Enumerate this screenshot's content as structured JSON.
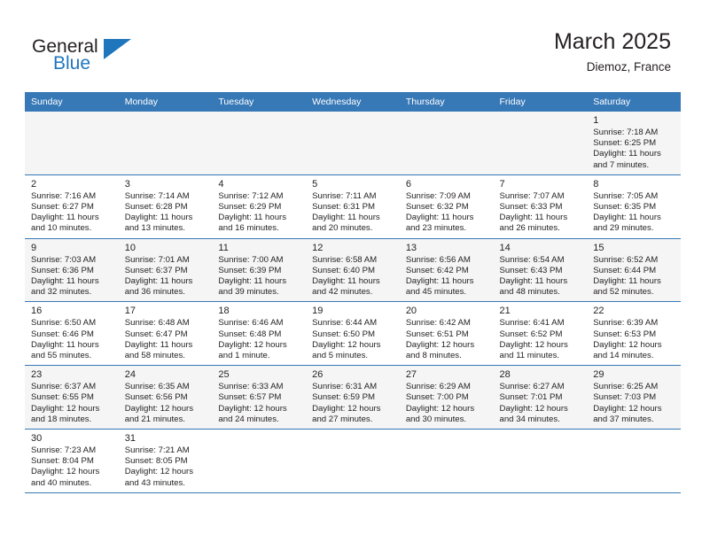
{
  "brand": {
    "name_part1": "General",
    "name_part2": "Blue",
    "logo_icon": "triangle-flag-icon"
  },
  "header": {
    "title": "March 2025",
    "location": "Diemoz, France"
  },
  "colors": {
    "header_blue": "#3778b6",
    "brand_blue": "#1f76bc",
    "text": "#231f20",
    "alt_row": "#f5f5f5"
  },
  "weekdays": [
    "Sunday",
    "Monday",
    "Tuesday",
    "Wednesday",
    "Thursday",
    "Friday",
    "Saturday"
  ],
  "calendar": {
    "weeks": [
      [
        {
          "day": "",
          "info": ""
        },
        {
          "day": "",
          "info": ""
        },
        {
          "day": "",
          "info": ""
        },
        {
          "day": "",
          "info": ""
        },
        {
          "day": "",
          "info": ""
        },
        {
          "day": "",
          "info": ""
        },
        {
          "day": "1",
          "info": "Sunrise: 7:18 AM\nSunset: 6:25 PM\nDaylight: 11 hours\nand 7 minutes."
        }
      ],
      [
        {
          "day": "2",
          "info": "Sunrise: 7:16 AM\nSunset: 6:27 PM\nDaylight: 11 hours\nand 10 minutes."
        },
        {
          "day": "3",
          "info": "Sunrise: 7:14 AM\nSunset: 6:28 PM\nDaylight: 11 hours\nand 13 minutes."
        },
        {
          "day": "4",
          "info": "Sunrise: 7:12 AM\nSunset: 6:29 PM\nDaylight: 11 hours\nand 16 minutes."
        },
        {
          "day": "5",
          "info": "Sunrise: 7:11 AM\nSunset: 6:31 PM\nDaylight: 11 hours\nand 20 minutes."
        },
        {
          "day": "6",
          "info": "Sunrise: 7:09 AM\nSunset: 6:32 PM\nDaylight: 11 hours\nand 23 minutes."
        },
        {
          "day": "7",
          "info": "Sunrise: 7:07 AM\nSunset: 6:33 PM\nDaylight: 11 hours\nand 26 minutes."
        },
        {
          "day": "8",
          "info": "Sunrise: 7:05 AM\nSunset: 6:35 PM\nDaylight: 11 hours\nand 29 minutes."
        }
      ],
      [
        {
          "day": "9",
          "info": "Sunrise: 7:03 AM\nSunset: 6:36 PM\nDaylight: 11 hours\nand 32 minutes."
        },
        {
          "day": "10",
          "info": "Sunrise: 7:01 AM\nSunset: 6:37 PM\nDaylight: 11 hours\nand 36 minutes."
        },
        {
          "day": "11",
          "info": "Sunrise: 7:00 AM\nSunset: 6:39 PM\nDaylight: 11 hours\nand 39 minutes."
        },
        {
          "day": "12",
          "info": "Sunrise: 6:58 AM\nSunset: 6:40 PM\nDaylight: 11 hours\nand 42 minutes."
        },
        {
          "day": "13",
          "info": "Sunrise: 6:56 AM\nSunset: 6:42 PM\nDaylight: 11 hours\nand 45 minutes."
        },
        {
          "day": "14",
          "info": "Sunrise: 6:54 AM\nSunset: 6:43 PM\nDaylight: 11 hours\nand 48 minutes."
        },
        {
          "day": "15",
          "info": "Sunrise: 6:52 AM\nSunset: 6:44 PM\nDaylight: 11 hours\nand 52 minutes."
        }
      ],
      [
        {
          "day": "16",
          "info": "Sunrise: 6:50 AM\nSunset: 6:46 PM\nDaylight: 11 hours\nand 55 minutes."
        },
        {
          "day": "17",
          "info": "Sunrise: 6:48 AM\nSunset: 6:47 PM\nDaylight: 11 hours\nand 58 minutes."
        },
        {
          "day": "18",
          "info": "Sunrise: 6:46 AM\nSunset: 6:48 PM\nDaylight: 12 hours\nand 1 minute."
        },
        {
          "day": "19",
          "info": "Sunrise: 6:44 AM\nSunset: 6:50 PM\nDaylight: 12 hours\nand 5 minutes."
        },
        {
          "day": "20",
          "info": "Sunrise: 6:42 AM\nSunset: 6:51 PM\nDaylight: 12 hours\nand 8 minutes."
        },
        {
          "day": "21",
          "info": "Sunrise: 6:41 AM\nSunset: 6:52 PM\nDaylight: 12 hours\nand 11 minutes."
        },
        {
          "day": "22",
          "info": "Sunrise: 6:39 AM\nSunset: 6:53 PM\nDaylight: 12 hours\nand 14 minutes."
        }
      ],
      [
        {
          "day": "23",
          "info": "Sunrise: 6:37 AM\nSunset: 6:55 PM\nDaylight: 12 hours\nand 18 minutes."
        },
        {
          "day": "24",
          "info": "Sunrise: 6:35 AM\nSunset: 6:56 PM\nDaylight: 12 hours\nand 21 minutes."
        },
        {
          "day": "25",
          "info": "Sunrise: 6:33 AM\nSunset: 6:57 PM\nDaylight: 12 hours\nand 24 minutes."
        },
        {
          "day": "26",
          "info": "Sunrise: 6:31 AM\nSunset: 6:59 PM\nDaylight: 12 hours\nand 27 minutes."
        },
        {
          "day": "27",
          "info": "Sunrise: 6:29 AM\nSunset: 7:00 PM\nDaylight: 12 hours\nand 30 minutes."
        },
        {
          "day": "28",
          "info": "Sunrise: 6:27 AM\nSunset: 7:01 PM\nDaylight: 12 hours\nand 34 minutes."
        },
        {
          "day": "29",
          "info": "Sunrise: 6:25 AM\nSunset: 7:03 PM\nDaylight: 12 hours\nand 37 minutes."
        }
      ],
      [
        {
          "day": "30",
          "info": "Sunrise: 7:23 AM\nSunset: 8:04 PM\nDaylight: 12 hours\nand 40 minutes."
        },
        {
          "day": "31",
          "info": "Sunrise: 7:21 AM\nSunset: 8:05 PM\nDaylight: 12 hours\nand 43 minutes."
        },
        {
          "day": "",
          "info": ""
        },
        {
          "day": "",
          "info": ""
        },
        {
          "day": "",
          "info": ""
        },
        {
          "day": "",
          "info": ""
        },
        {
          "day": "",
          "info": ""
        }
      ]
    ]
  }
}
